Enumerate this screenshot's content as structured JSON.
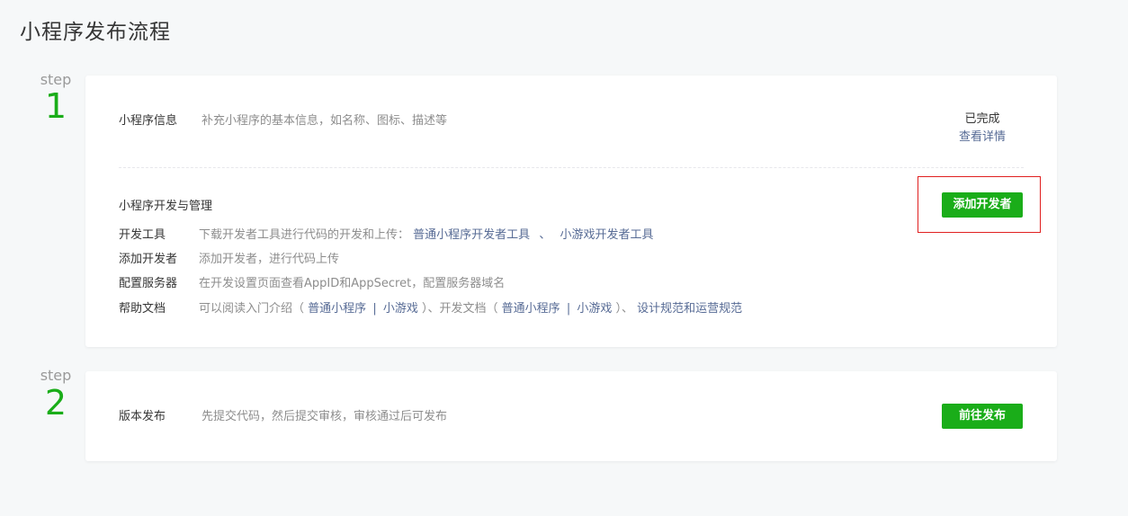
{
  "page": {
    "title": "小程序发布流程"
  },
  "step1": {
    "step_label": "step",
    "step_number": "1",
    "info": {
      "title": "小程序信息",
      "desc": "补充小程序的基本信息，如名称、图标、描述等",
      "status": "已完成",
      "detail_link": "查看详情"
    },
    "dev": {
      "title": "小程序开发与管理",
      "add_dev_button": "添加开发者",
      "rows": [
        {
          "label": "开发工具",
          "desc": "下载开发者工具进行代码的开发和上传：",
          "link1": "普通小程序开发者工具",
          "sep1": "、",
          "link2": "小游戏开发者工具"
        },
        {
          "label": "添加开发者",
          "desc": "添加开发者，进行代码上传"
        },
        {
          "label": "配置服务器",
          "desc": "在开发设置页面查看AppID和AppSecret，配置服务器域名"
        },
        {
          "label": "帮助文档",
          "desc_a": "可以阅读入门介绍（",
          "link_a1": "普通小程序",
          "pipe_a": "|",
          "link_a2": "小游戏",
          "desc_b": "）、开发文档（",
          "link_b1": "普通小程序",
          "pipe_b": "|",
          "link_b2": "小游戏",
          "desc_c": "）、",
          "link_c": "设计规范和运营规范"
        }
      ]
    }
  },
  "step2": {
    "step_label": "step",
    "step_number": "2",
    "title": "版本发布",
    "desc": "先提交代码，然后提交审核，审核通过后可发布",
    "publish_button": "前往发布"
  },
  "colors": {
    "accent_green": "#1aad19",
    "link_blue": "#576b95",
    "highlight_red": "#e02020"
  }
}
